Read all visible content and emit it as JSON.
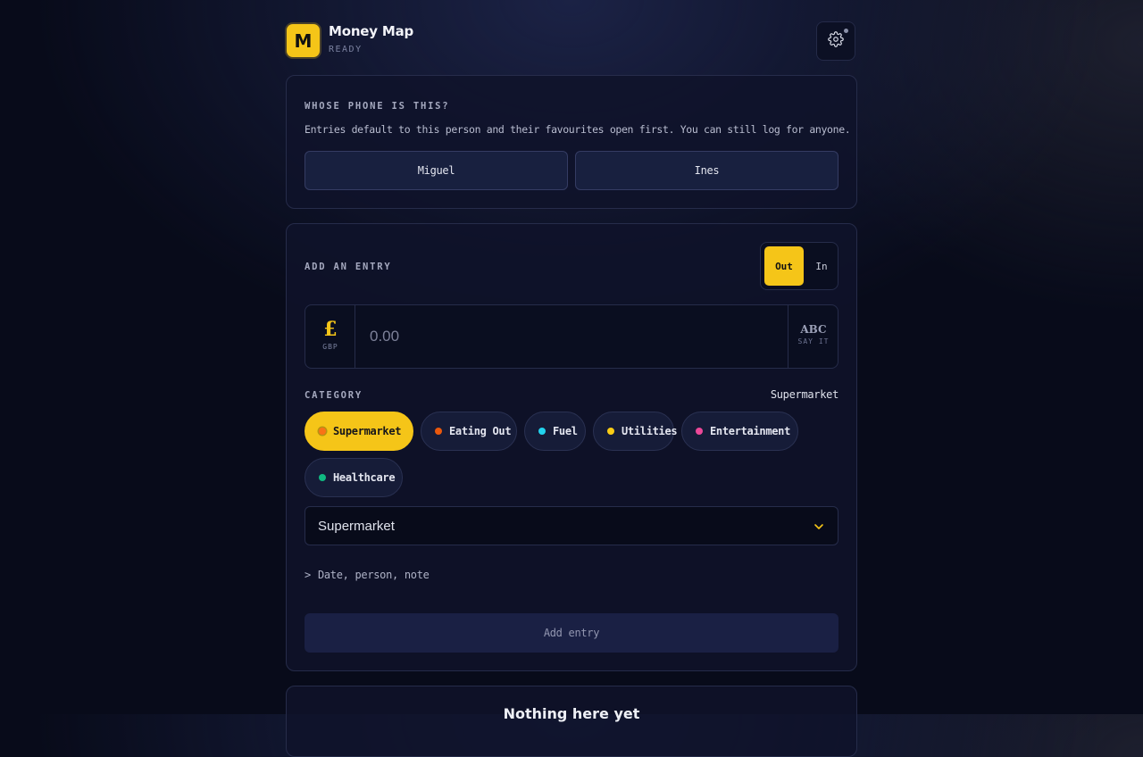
{
  "app": {
    "logo_letter": "M",
    "title": "Money Map",
    "status": "READY"
  },
  "header": {
    "settings_icon": "gear-icon"
  },
  "phone": {
    "label": "WHOSE PHONE IS THIS?",
    "description": "Entries default to this person and their favourites open first. You can still log for anyone.",
    "people": [
      "Miguel",
      "Ines"
    ]
  },
  "entry": {
    "label": "ADD AN ENTRY",
    "direction": {
      "out_label": "Out",
      "in_label": "In",
      "selected": "Out"
    },
    "currency_symbol": "£",
    "currency_code": "GBP",
    "amount_placeholder": "0.00",
    "amount_value": "",
    "say_it": {
      "abc": "ABC",
      "label": "SAY IT"
    },
    "category_label": "CATEGORY",
    "category_selected": "Supermarket",
    "categories": [
      {
        "label": "Supermarket",
        "color": "#f97316",
        "active": true
      },
      {
        "label": "Eating Out",
        "color": "#ea580c",
        "active": false
      },
      {
        "label": "Fuel",
        "color": "#22d3ee",
        "active": false
      },
      {
        "label": "Utilities",
        "color": "#facc15",
        "active": false
      },
      {
        "label": "Entertainment",
        "color": "#ec4899",
        "active": false
      },
      {
        "label": "Healthcare",
        "color": "#10b981",
        "active": false
      }
    ],
    "select_value": "Supermarket",
    "details_caret": ">",
    "details_label": "Date, person, note",
    "add_button": "Add entry"
  },
  "list": {
    "empty_title": "Nothing here yet"
  },
  "colors": {
    "accent": "#f5c518",
    "background": "#080b1a",
    "card": "#0f132a"
  }
}
